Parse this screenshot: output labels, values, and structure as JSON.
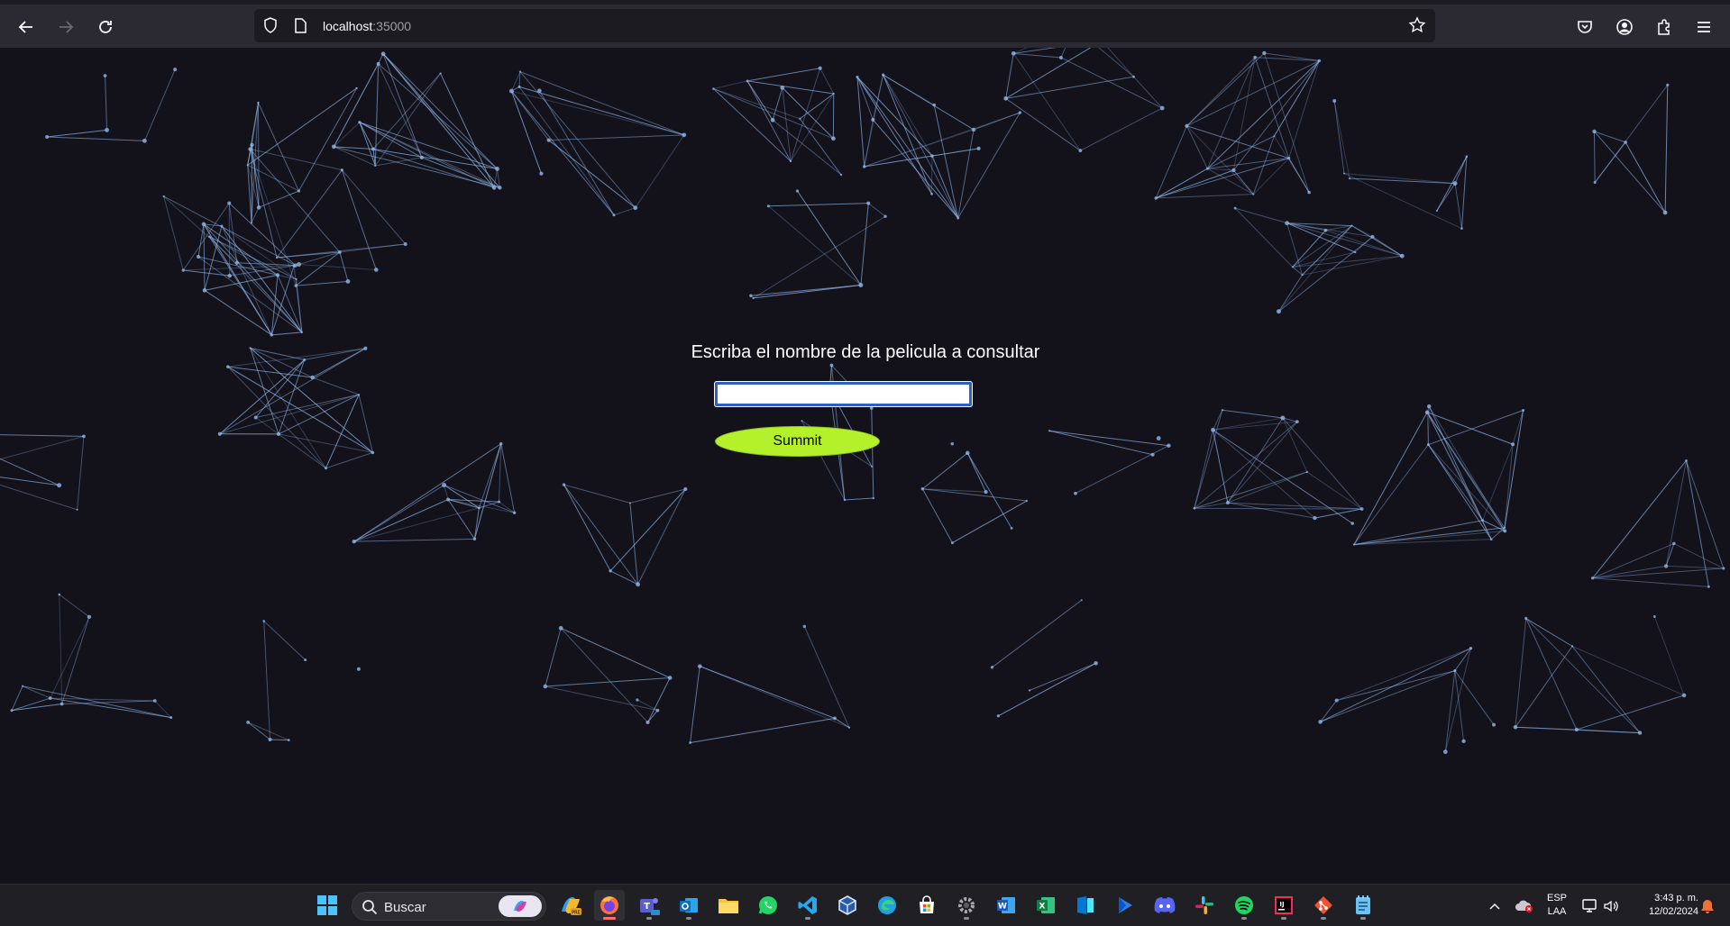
{
  "browser": {
    "url_host": "localhost",
    "url_port": ":35000"
  },
  "page": {
    "prompt": "Escriba el nombre de la pelicula a consultar",
    "input_value": "",
    "submit_label": "Summit"
  },
  "taskbar": {
    "search_placeholder": "Buscar",
    "pinned_apps": [
      "start-icon",
      "copilot-icon",
      "firefox-icon",
      "teams-icon",
      "outlook-icon",
      "file-explorer-icon",
      "whatsapp-icon",
      "vscode-icon",
      "virtualbox-icon",
      "edge-icon",
      "store-icon",
      "settings-icon",
      "word-icon",
      "excel-icon",
      "azure-data-studio-icon",
      "power-automate-icon",
      "discord-icon",
      "slack-icon",
      "spotify-icon",
      "intellij-icon",
      "git-icon",
      "notepad-icon"
    ],
    "language_line1": "ESP",
    "language_line2": "LAA",
    "time": "3:43 p. m.",
    "date": "12/02/2024"
  },
  "colors": {
    "background": "#13111a",
    "network_line": "#8fb6e8",
    "submit_bg": "#b4f12a",
    "input_border": "#2d5fc5"
  }
}
